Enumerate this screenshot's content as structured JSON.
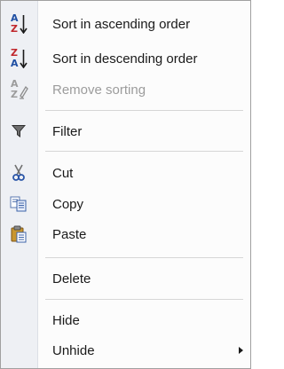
{
  "menu": {
    "items": [
      {
        "label": "Sort in ascending order",
        "icon": "sort-ascending-icon",
        "enabled": true
      },
      {
        "label": "Sort in descending order",
        "icon": "sort-descending-icon",
        "enabled": true
      },
      {
        "label": "Remove sorting",
        "icon": "remove-sorting-icon",
        "enabled": false
      },
      {
        "label": "Filter",
        "icon": "filter-icon",
        "enabled": true
      },
      {
        "label": "Cut",
        "icon": "cut-icon",
        "enabled": true
      },
      {
        "label": "Copy",
        "icon": "copy-icon",
        "enabled": true
      },
      {
        "label": "Paste",
        "icon": "paste-icon",
        "enabled": true
      },
      {
        "label": "Delete",
        "icon": "",
        "enabled": true
      },
      {
        "label": "Hide",
        "icon": "",
        "enabled": true
      },
      {
        "label": "Unhide",
        "icon": "",
        "enabled": true,
        "has_submenu": true
      }
    ],
    "icon_glyphs": {
      "az_top": "A",
      "az_bottom": "Z",
      "za_top": "Z",
      "za_bottom": "A"
    }
  },
  "colors": {
    "sort_red": "#c0282d",
    "sort_blue": "#1f4fa3",
    "disabled_text": "#9c9c9c",
    "gutter": "#eef0f4"
  }
}
